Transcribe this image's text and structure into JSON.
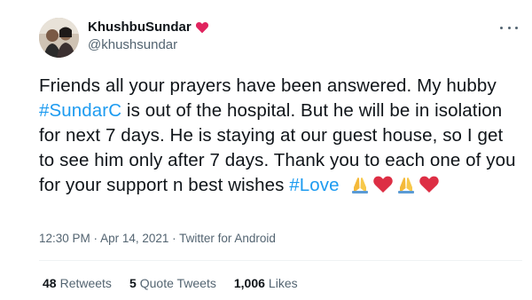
{
  "author": {
    "display_name": "KhushbuSundar",
    "handle": "@khushsundar"
  },
  "tweet": {
    "line_parts": [
      "Friends all your prayers have been answered. My hubby ",
      "#SundarC",
      " is out of the hospital. But he will be in isolation for next 7 days. He is staying at our guest house, so I get to see him only after 7 days. Thank you to each one of you for your support n best wishes ",
      "#Love"
    ],
    "emojis": [
      "folded-hands",
      "red-heart",
      "folded-hands",
      "red-heart"
    ]
  },
  "meta": {
    "time": "12:30 PM",
    "separator1": " · ",
    "date": "Apr 14, 2021",
    "separator2": " · ",
    "source": "Twitter for Android"
  },
  "stats": {
    "retweets_count": "48",
    "retweets_label": "Retweets",
    "quote_count": "5",
    "quote_label": "Quote Tweets",
    "likes_count": "1,006",
    "likes_label": "Likes"
  },
  "colors": {
    "link": "#1d9bf0",
    "heart": "#e0245e",
    "secondary_text": "#536471"
  }
}
